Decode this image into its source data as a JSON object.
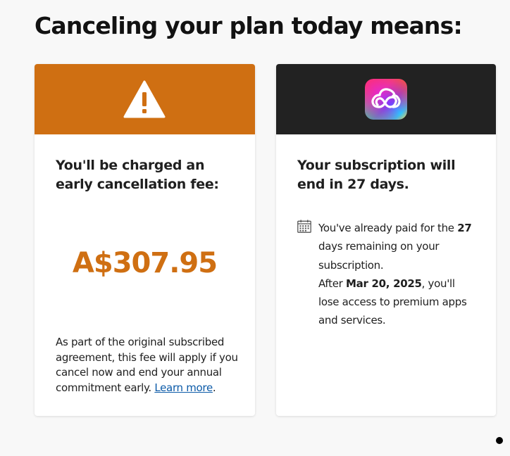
{
  "page": {
    "title": "Canceling your plan today means:"
  },
  "fee_card": {
    "banner_color": "#cf6f12",
    "icon": "warning-icon",
    "heading": "You'll be charged an early cancellation fee:",
    "amount": "A$307.95",
    "amount_color": "#cf6f12",
    "note_text": "As part of the original subscribed agreement, this fee will apply if you cancel now and end your annual commitment early.",
    "learn_more_label": "Learn more",
    "note_end": ".",
    "link_color": "#0b5aa8"
  },
  "subscription_card": {
    "banner_color": "#222222",
    "icon": "creative-cloud-logo-icon",
    "heading": "Your subscription will end in 27 days.",
    "info_icon": "calendar-icon",
    "line1_pre": "You've already paid for the ",
    "days_count": "27",
    "line1_post": " days remaining on your subscription.",
    "line2_pre": "After ",
    "end_date": "Mar 20, 2025",
    "line2_post": ", you'll lose access to premium apps and services."
  }
}
